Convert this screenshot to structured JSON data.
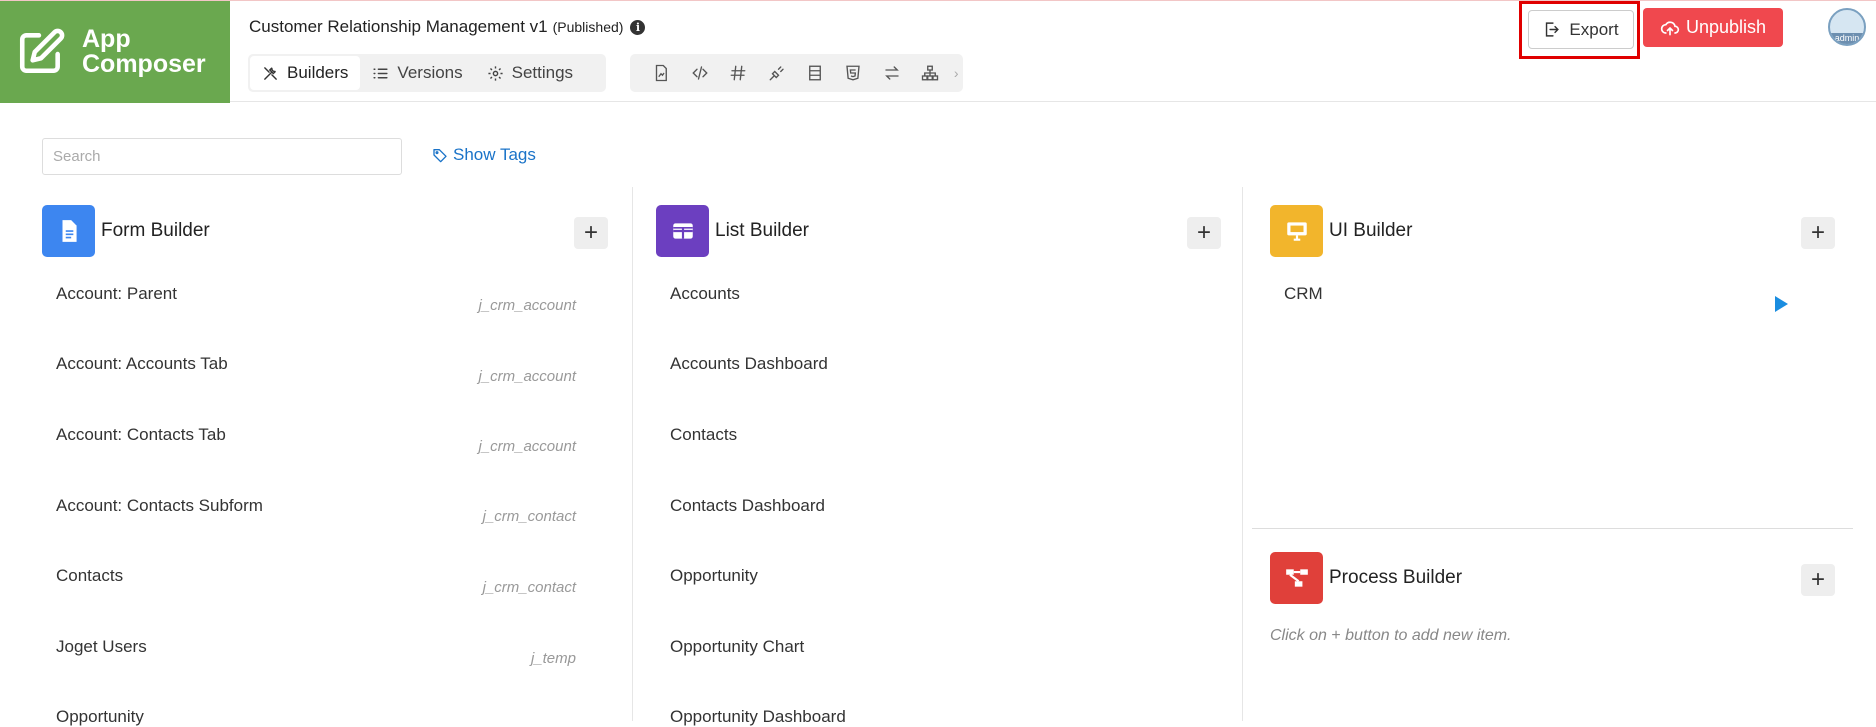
{
  "logo": {
    "line1": "App",
    "line2": "Composer"
  },
  "app": {
    "title": "Customer Relationship Management v1",
    "status": "(Published)"
  },
  "tabs": [
    {
      "label": "Builders",
      "icon": "tools-icon",
      "active": true
    },
    {
      "label": "Versions",
      "icon": "list-icon",
      "active": false
    },
    {
      "label": "Settings",
      "icon": "gear-icon",
      "active": false
    }
  ],
  "tools": [
    "file-chart-icon",
    "code-icon",
    "hash-icon",
    "plug-icon",
    "table-icon",
    "html5-icon",
    "arrows-icon",
    "sitemap-icon"
  ],
  "actions": {
    "export": "Export",
    "unpublish": "Unpublish",
    "avatar_label": "admin"
  },
  "search": {
    "placeholder": "Search"
  },
  "show_tags": "Show Tags",
  "form_builder": {
    "title": "Form Builder",
    "items": [
      {
        "label": "Account: Parent",
        "tag": "j_crm_account"
      },
      {
        "label": "Account: Accounts Tab",
        "tag": "j_crm_account"
      },
      {
        "label": "Account: Contacts Tab",
        "tag": "j_crm_account"
      },
      {
        "label": "Account: Contacts Subform",
        "tag": "j_crm_contact"
      },
      {
        "label": "Contacts",
        "tag": "j_crm_contact"
      },
      {
        "label": "Joget Users",
        "tag": "j_temp"
      },
      {
        "label": "Opportunity",
        "tag": ""
      }
    ]
  },
  "list_builder": {
    "title": "List Builder",
    "items": [
      "Accounts",
      "Accounts Dashboard",
      "Contacts",
      "Contacts Dashboard",
      "Opportunity",
      "Opportunity Chart",
      "Opportunity Dashboard"
    ]
  },
  "ui_builder": {
    "title": "UI Builder",
    "items": [
      "CRM"
    ]
  },
  "process_builder": {
    "title": "Process Builder",
    "hint_pre": "Click on",
    "hint_post": "button to add new item."
  },
  "colors": {
    "form": "#3d86f0",
    "list": "#6c3fc0",
    "ui": "#f2b52c",
    "process": "#e0403a",
    "logo": "#6aa84f"
  }
}
